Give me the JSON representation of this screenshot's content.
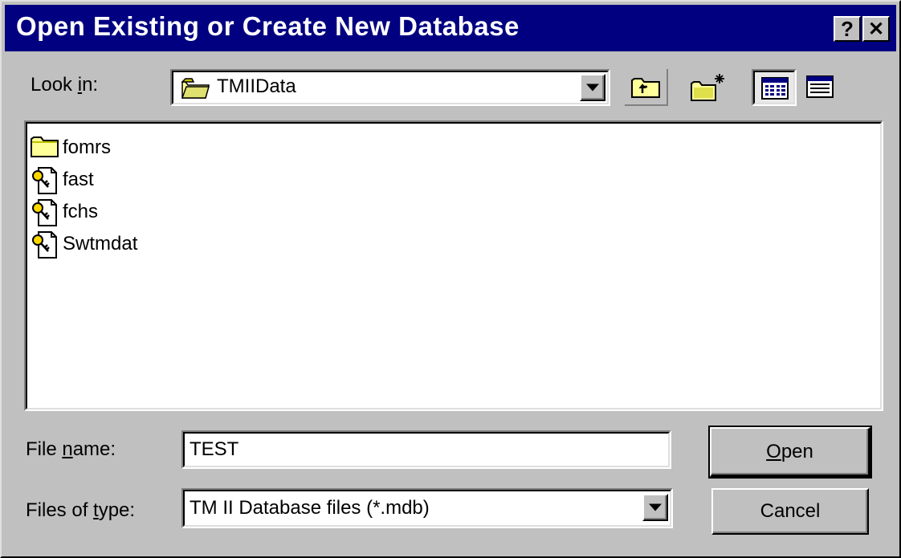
{
  "window": {
    "title": "Open Existing or Create New Database",
    "help_button": "?",
    "close_button": "✕"
  },
  "look_in": {
    "label_pre": "Look ",
    "label_ul": "i",
    "label_post": "n:",
    "value": "TMIIData"
  },
  "toolbar": {
    "up_folder": "up-one-level-icon",
    "new_folder": "create-new-folder-icon",
    "list_view": "list-view-icon",
    "details_view": "details-view-icon"
  },
  "files": [
    {
      "name": "fomrs",
      "icon": "folder-icon"
    },
    {
      "name": "fast",
      "icon": "database-file-icon"
    },
    {
      "name": "fchs",
      "icon": "database-file-icon"
    },
    {
      "name": "Swtmdat",
      "icon": "database-file-icon"
    }
  ],
  "file_name": {
    "label_pre": "File ",
    "label_ul": "n",
    "label_post": "ame:",
    "value": "TEST"
  },
  "file_type": {
    "label_pre": "Files of ",
    "label_ul": "t",
    "label_post": "ype:",
    "value": "TM II Database files (*.mdb)"
  },
  "buttons": {
    "open_ul": "O",
    "open_rest": "pen",
    "cancel": "Cancel"
  }
}
